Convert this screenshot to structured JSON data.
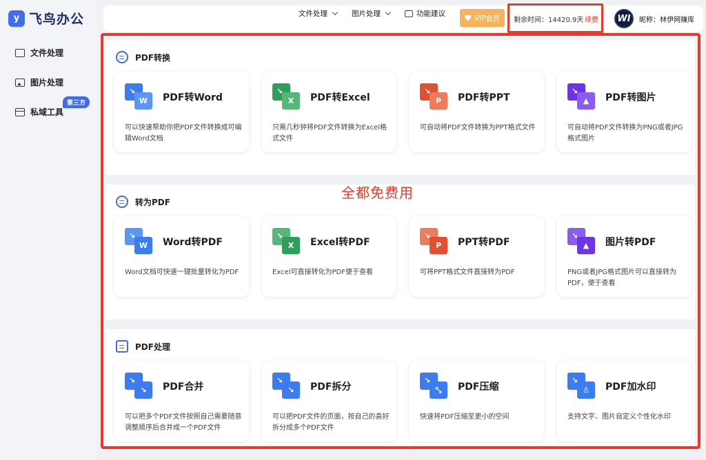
{
  "app": {
    "name": "飞鸟办公",
    "logo_glyph": "y"
  },
  "sidebar": {
    "items": [
      {
        "label": "文件处理",
        "icon": "folder-icon"
      },
      {
        "label": "图片处理",
        "icon": "image-icon"
      },
      {
        "label": "私域工具",
        "icon": "toolbox-icon"
      }
    ],
    "badge": "第三方"
  },
  "header": {
    "nav": [
      {
        "label": "文件处理"
      },
      {
        "label": "图片处理"
      },
      {
        "label": "功能建议"
      }
    ],
    "vip_label": "VIP会员",
    "remaining": "剩余时间：14420.9天",
    "renew_label": "续费",
    "avatar_text": "WI",
    "nickname": "昵称：林伊网赚库"
  },
  "annotation": "全都免费用",
  "sections": [
    {
      "title": "PDF转换",
      "cards": [
        {
          "title": "PDF转Word",
          "desc": "可以快速帮助你把PDF文件转换成可编辑Word文档",
          "glyph": "W",
          "color_a": "#3b7cf2",
          "color_b": "#5b95f7"
        },
        {
          "title": "PDF转Excel",
          "desc": "只需几秒钟将PDF文件转换为Excel格式文件",
          "glyph": "X",
          "color_a": "#2f9e5b",
          "color_b": "#55b87a"
        },
        {
          "title": "PDF转PPT",
          "desc": "可自动将PDF文件转换为PPT格式文件",
          "glyph": "P",
          "color_a": "#e2502f",
          "color_b": "#ef7a5c"
        },
        {
          "title": "PDF转图片",
          "desc": "可自动将PDF文件转换为PNG或者JPG格式图片",
          "glyph": "▲",
          "color_a": "#6b34e6",
          "color_b": "#8b5cf0"
        }
      ]
    },
    {
      "title": "转为PDF",
      "cards": [
        {
          "title": "Word转PDF",
          "desc": "Word文档可快速一键批量转化为PDF",
          "glyph": "W",
          "color_a": "#5b95f7",
          "color_b": "#3b7cf2"
        },
        {
          "title": "Excel转PDF",
          "desc": "Excel可直接转化为PDF便于查看",
          "glyph": "X",
          "color_a": "#55b87a",
          "color_b": "#2f9e5b"
        },
        {
          "title": "PPT转PDF",
          "desc": "可将PPT格式文件直接转为PDF",
          "glyph": "P",
          "color_a": "#ef7a5c",
          "color_b": "#e2502f"
        },
        {
          "title": "图片转PDF",
          "desc": "PNG或者JPG格式图片可以直接转为PDF，便于查看",
          "glyph": "▲",
          "color_a": "#8b5cf0",
          "color_b": "#6b34e6"
        }
      ]
    },
    {
      "title": "PDF处理",
      "cards": [
        {
          "title": "PDF合并",
          "desc": "可以把多个PDF文件按照自己需要随意调整顺序后合并成一个PDF文件",
          "glyph": "↘",
          "color_a": "#3b7cf2",
          "color_b": "#3b7cf2"
        },
        {
          "title": "PDF拆分",
          "desc": "可以把PDF文件的页面，按自己的喜好拆分成多个PDF文件",
          "glyph": "↘",
          "color_a": "#3b7cf2",
          "color_b": "#3b7cf2"
        },
        {
          "title": "PDF压缩",
          "desc": "快速将PDF压缩至更小的空间",
          "glyph": "⤡",
          "color_a": "#3b7cf2",
          "color_b": "#3b7cf2"
        },
        {
          "title": "PDF加水印",
          "desc": "支持文字、图片自定义个性化水印",
          "glyph": "♙",
          "color_a": "#3b7cf2",
          "color_b": "#3b7cf2"
        }
      ]
    }
  ]
}
